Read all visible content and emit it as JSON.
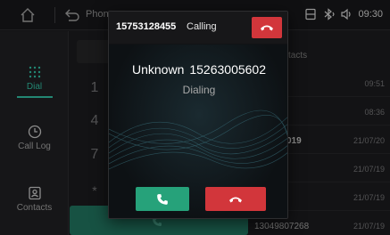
{
  "statusbar": {
    "app_title": "Phone",
    "clock": "09:30",
    "icons": [
      "home-icon",
      "back-icon",
      "sim-icon",
      "bluetooth-icon",
      "volume-icon"
    ]
  },
  "sidebar": {
    "items": [
      {
        "label": "Dial",
        "icon": "dialpad-icon",
        "active": true
      },
      {
        "label": "Call Log",
        "icon": "clock-icon",
        "active": false
      },
      {
        "label": "Contacts",
        "icon": "contacts-icon",
        "active": false
      }
    ]
  },
  "keypad": {
    "keys": [
      "1",
      "4",
      "7",
      "*"
    ],
    "call_icon": "phone-icon"
  },
  "recents": {
    "header": "tacts",
    "rows": [
      {
        "name": "",
        "time": "09:51"
      },
      {
        "name": "",
        "time": "08:36"
      },
      {
        "name": "019",
        "time": "21/07/20"
      },
      {
        "name": "",
        "time": "21/07/19"
      },
      {
        "name": "",
        "time": "21/07/19"
      },
      {
        "name": "13049807268",
        "time": "21/07/19"
      }
    ]
  },
  "call_dialog": {
    "number": "15753128455",
    "status": "Calling",
    "caller_name": "Unknown",
    "caller_number": "15263005602",
    "dialing_text": "Dialing",
    "colors": {
      "answer": "#26a27a",
      "decline": "#d2363b"
    }
  }
}
